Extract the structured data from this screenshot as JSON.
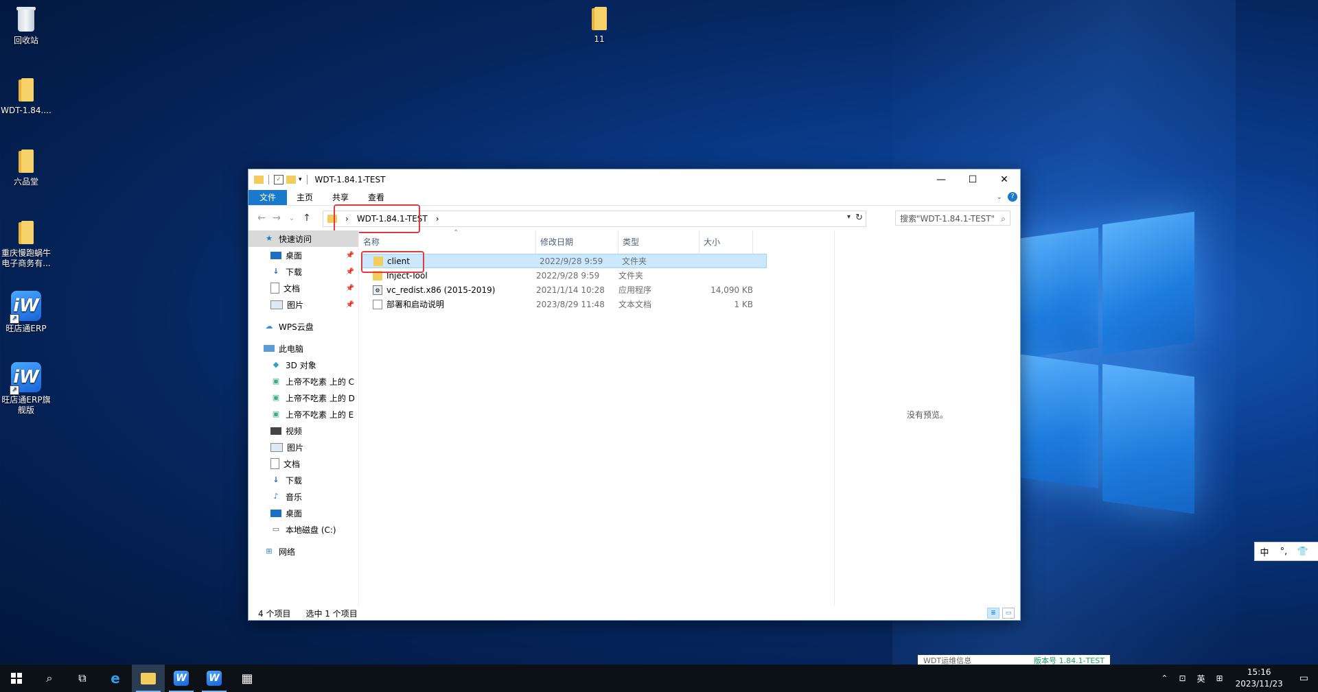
{
  "desktop": {
    "icons": [
      {
        "label": "回收站"
      },
      {
        "label": "WDT-1.84...."
      },
      {
        "label": "六品堂"
      },
      {
        "label": "重庆慢跑蜗牛电子商务有..."
      },
      {
        "label": "旺店通ERP"
      },
      {
        "label": "旺店通ERP旗舰版"
      },
      {
        "label": "11"
      }
    ]
  },
  "window": {
    "title": "WDT-1.84.1-TEST",
    "caption": {
      "minimize": "—",
      "maximize": "☐",
      "close": "✕"
    },
    "ribbon_tabs": [
      "文件",
      "主页",
      "共享",
      "查看"
    ],
    "address": {
      "crumb": "WDT-1.84.1-TEST",
      "prefix_chevron": "›",
      "suffix_chevron": "›"
    },
    "search_placeholder": "搜索\"WDT-1.84.1-TEST\"",
    "nav": {
      "quick_access": "快速访问",
      "quick_items": [
        "桌面",
        "下载",
        "文档",
        "图片"
      ],
      "wps": "WPS云盘",
      "this_pc": "此电脑",
      "pc_items": [
        "3D 对象",
        "上帝不吃素 上的 C",
        "上帝不吃素 上的 D",
        "上帝不吃素 上的 E",
        "视频",
        "图片",
        "文档",
        "下载",
        "音乐",
        "桌面",
        "本地磁盘 (C:)"
      ],
      "network": "网络"
    },
    "columns": [
      "名称",
      "修改日期",
      "类型",
      "大小"
    ],
    "files": [
      {
        "name": "client",
        "date": "2022/9/28 9:59",
        "type": "文件夹",
        "size": "",
        "icon": "folder-icon"
      },
      {
        "name": "Inject-Tool",
        "date": "2022/9/28 9:59",
        "type": "文件夹",
        "size": "",
        "icon": "folder-icon"
      },
      {
        "name": "vc_redist.x86 (2015-2019)",
        "date": "2021/1/14 10:28",
        "type": "应用程序",
        "size": "14,090 KB",
        "icon": "installer-icon"
      },
      {
        "name": "部署和启动说明",
        "date": "2023/8/29 11:48",
        "type": "文本文档",
        "size": "1 KB",
        "icon": "text-file-icon"
      }
    ],
    "preview_message": "没有预览。",
    "status": {
      "count": "4 个项目",
      "selected": "选中 1 个项目"
    }
  },
  "ime": {
    "lang": "中",
    "punct": "°,",
    "skin": "👕"
  },
  "popup": {
    "left": "WDT运维信息",
    "right": "版本号 1.84.1-TEST"
  },
  "taskbar": {
    "tray_lang": "英",
    "time": "15:16",
    "date": "2023/11/23"
  },
  "colors": {
    "accent": "#1979ca",
    "highlight": "#e0393e",
    "selection": "#cce8ff"
  }
}
